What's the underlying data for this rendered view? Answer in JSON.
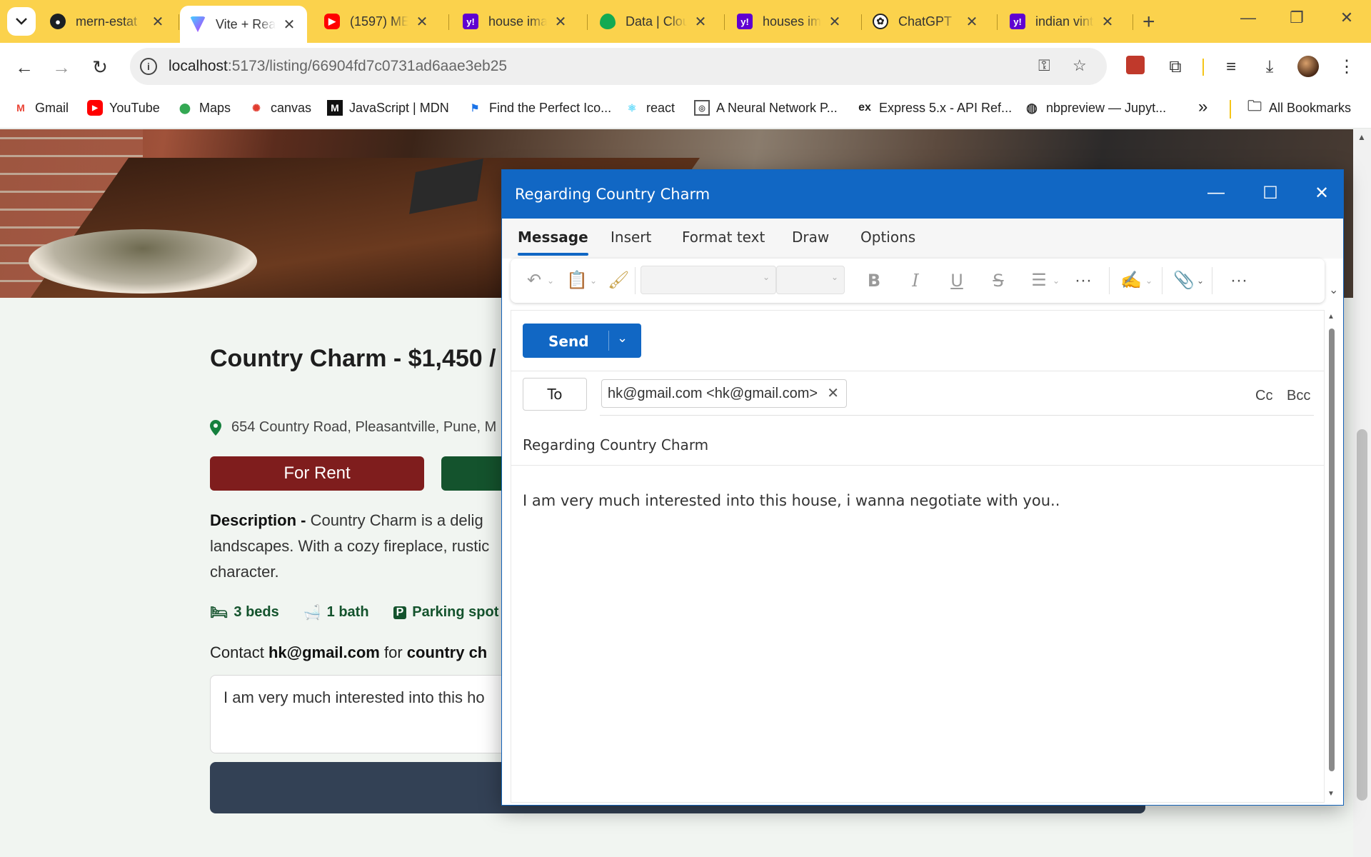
{
  "browser": {
    "tabs": [
      {
        "title": "mern-estat",
        "icon": "github-icon",
        "color": "#1b1f23"
      },
      {
        "title": "Vite + Rea",
        "icon": "vite-icon",
        "color": "#8a5cf6",
        "active": true
      },
      {
        "title": "(1597) MEI",
        "icon": "youtube-icon",
        "color": "#ff0000"
      },
      {
        "title": "house ima",
        "icon": "yahoo-icon",
        "color": "#5f01d1"
      },
      {
        "title": "Data | Clou",
        "icon": "mongodb-icon",
        "color": "#13aa52"
      },
      {
        "title": "houses im",
        "icon": "yahoo-icon",
        "color": "#5f01d1"
      },
      {
        "title": "ChatGPT",
        "icon": "openai-icon",
        "color": "#222222"
      },
      {
        "title": "indian vint",
        "icon": "yahoo-icon",
        "color": "#5f01d1"
      }
    ],
    "url_host": "localhost",
    "url_path": ":5173/listing/66904fd7c0731ad6aae3eb25",
    "bookmarks": [
      {
        "label": "Gmail",
        "icon": "gmail-icon"
      },
      {
        "label": "YouTube",
        "icon": "youtube-icon"
      },
      {
        "label": "Maps",
        "icon": "maps-icon"
      },
      {
        "label": "canvas",
        "icon": "canvas-icon"
      },
      {
        "label": "JavaScript | MDN",
        "icon": "mdn-icon"
      },
      {
        "label": "Find the Perfect Ico...",
        "icon": "flag-icon"
      },
      {
        "label": "react",
        "icon": "react-icon"
      },
      {
        "label": "A Neural Network P...",
        "icon": "playground-icon"
      },
      {
        "label": "Express 5.x - API Ref...",
        "icon": "express-icon"
      },
      {
        "label": "nbpreview — Jupyt...",
        "icon": "globe-icon"
      }
    ],
    "more_bookmarks": "»",
    "all_bookmarks": "All Bookmarks"
  },
  "listing": {
    "title": "Country Charm - $1,450 /",
    "address": "654 Country Road, Pleasantville, Pune, M",
    "type_label": "For Rent",
    "description_label": "Description - ",
    "description": "Country Charm is a delig",
    "description_line2": "landscapes. With a cozy fireplace, rustic",
    "description_line3": "character.",
    "beds": "3 beds",
    "baths": "1 bath",
    "parking": "Parking spot",
    "contact_prefix": "Contact ",
    "contact_email": "hk@gmail.com",
    "contact_for": " for ",
    "contact_name": "country ch",
    "message": "I am very much interested into this ho"
  },
  "compose": {
    "window_title": "Regarding Country Charm",
    "tabs": [
      "Message",
      "Insert",
      "Format text",
      "Draw",
      "Options"
    ],
    "send_label": "Send",
    "to_label": "To",
    "recipient": "hk@gmail.com <hk@gmail.com>",
    "cc_label": "Cc",
    "bcc_label": "Bcc",
    "subject": "Regarding Country Charm",
    "body": "I am very much interested into this house, i wanna negotiate with you.."
  }
}
